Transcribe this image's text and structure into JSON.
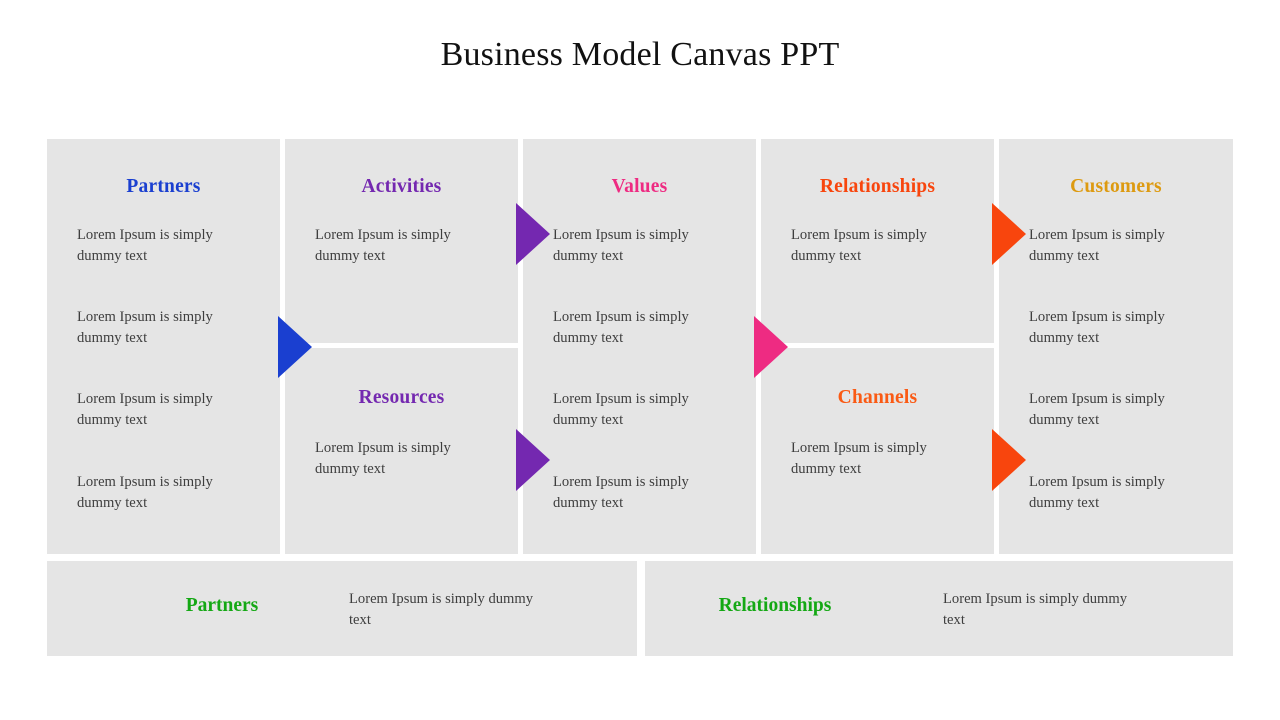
{
  "slide": {
    "title": "Business Model Canvas PPT",
    "background": "#ffffff",
    "panel_bg": "#e5e5e5"
  },
  "body_text": "Lorem Ipsum is simply dummy text",
  "columns": [
    {
      "id": "partners",
      "title": "Partners",
      "color": "#1a3fd0",
      "split": false,
      "lines": [
        "Lorem Ipsum is simply dummy text",
        "Lorem Ipsum is simply dummy text",
        "Lorem Ipsum is simply dummy text",
        "Lorem Ipsum is simply dummy text"
      ]
    },
    {
      "id": "activities",
      "title": "Activities",
      "color": "#7428b0",
      "split": true,
      "lines": [
        "Lorem Ipsum is simply dummy text"
      ],
      "sub": {
        "id": "resources",
        "title": "Resources",
        "color": "#7428b0",
        "lines": [
          "Lorem Ipsum is simply dummy text"
        ]
      }
    },
    {
      "id": "values",
      "title": "Values",
      "color": "#ee2b82",
      "split": false,
      "lines": [
        "Lorem Ipsum is simply dummy text",
        "Lorem Ipsum is simply dummy text",
        "Lorem Ipsum is simply dummy text",
        "Lorem Ipsum is simply dummy text"
      ]
    },
    {
      "id": "relationships",
      "title": "Relationships",
      "color": "#f8450d",
      "split": true,
      "lines": [
        "Lorem Ipsum is simply dummy text"
      ],
      "sub": {
        "id": "channels",
        "title": "Channels",
        "color": "#fa5a14",
        "lines": [
          "Lorem Ipsum is simply dummy text"
        ]
      }
    },
    {
      "id": "customers",
      "title": "Customers",
      "color": "#dd9a10",
      "split": false,
      "lines": [
        "Lorem Ipsum is simply dummy text",
        "Lorem Ipsum is simply dummy text",
        "Lorem Ipsum is simply dummy text",
        "Lorem Ipsum is simply dummy text"
      ]
    }
  ],
  "arrows": [
    {
      "id": "partners-to-activities",
      "color": "#1a3fd0",
      "direction": "right"
    },
    {
      "id": "activities-to-values",
      "color": "#7428b0",
      "direction": "right"
    },
    {
      "id": "resources-to-values",
      "color": "#7428b0",
      "direction": "right"
    },
    {
      "id": "values-to-relationships",
      "color": "#ee2b82",
      "direction": "right"
    },
    {
      "id": "relationships-to-customers",
      "color": "#f8450d",
      "direction": "right"
    },
    {
      "id": "channels-to-customers",
      "color": "#f8450d",
      "direction": "right"
    }
  ],
  "bottom_bars": [
    {
      "id": "bottom-partners",
      "title": "Partners",
      "color": "#14a814",
      "text": "Lorem Ipsum is simply dummy text"
    },
    {
      "id": "bottom-relationships",
      "title": "Relationships",
      "color": "#14a814",
      "text": "Lorem Ipsum is simply dummy text"
    }
  ]
}
